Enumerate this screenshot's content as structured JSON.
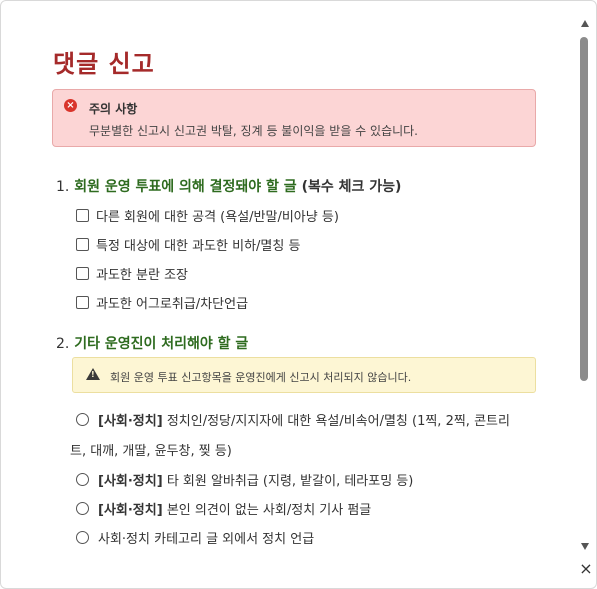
{
  "dialog": {
    "title": "댓글 신고",
    "close_label": "×"
  },
  "notice": {
    "title": "주의 사항",
    "body": "무분별한 신고시 신고권 박탈, 징계 등 불이익을 받을 수 있습니다.",
    "icon": "error-icon",
    "icon_glyph": "×",
    "color": "#fcd5d5"
  },
  "section1": {
    "number": "1.",
    "title": "회원 운영 투표에 의해 결정돼야 할 글",
    "note": "(복수 체크 가능)",
    "options": [
      {
        "label": "다른 회원에 대한 공격 (욕설/반말/비아냥 등)",
        "checked": false
      },
      {
        "label": "특정 대상에 대한 과도한 비하/멸칭 등",
        "checked": false
      },
      {
        "label": "과도한 분란 조장",
        "checked": false
      },
      {
        "label": "과도한 어그로취급/차단언급",
        "checked": false
      }
    ]
  },
  "section2": {
    "number": "2.",
    "title": "기타 운영진이 처리해야 할 글",
    "warning": "회원 운영 투표 신고항목을 운영진에게 신고시 처리되지 않습니다.",
    "warning_icon": "warning-icon",
    "options": [
      {
        "tag": "[사회·정치]",
        "label": "정치인/정당/지지자에 대한 욕설/비속어/멸칭 (1찍, 2찍, 콘트리",
        "label_cont": "트, 대깨, 개딸, 윤두창, 찢 등)",
        "selected": false
      },
      {
        "tag": "[사회·정치]",
        "label": "타 회원 알바취급 (지령, 밭갈이, 테라포밍 등)",
        "selected": false
      },
      {
        "tag": "[사회·정치]",
        "label": "본인 의견이 없는 사회/정치 기사 펌글",
        "selected": false
      },
      {
        "tag": "",
        "label": "사회·정치 카테고리 글 외에서 정치 언급",
        "selected": false
      }
    ]
  },
  "colors": {
    "title": "#a52a2a",
    "section_title": "#2e6b1f",
    "warning_bg": "#fdf6d4"
  }
}
